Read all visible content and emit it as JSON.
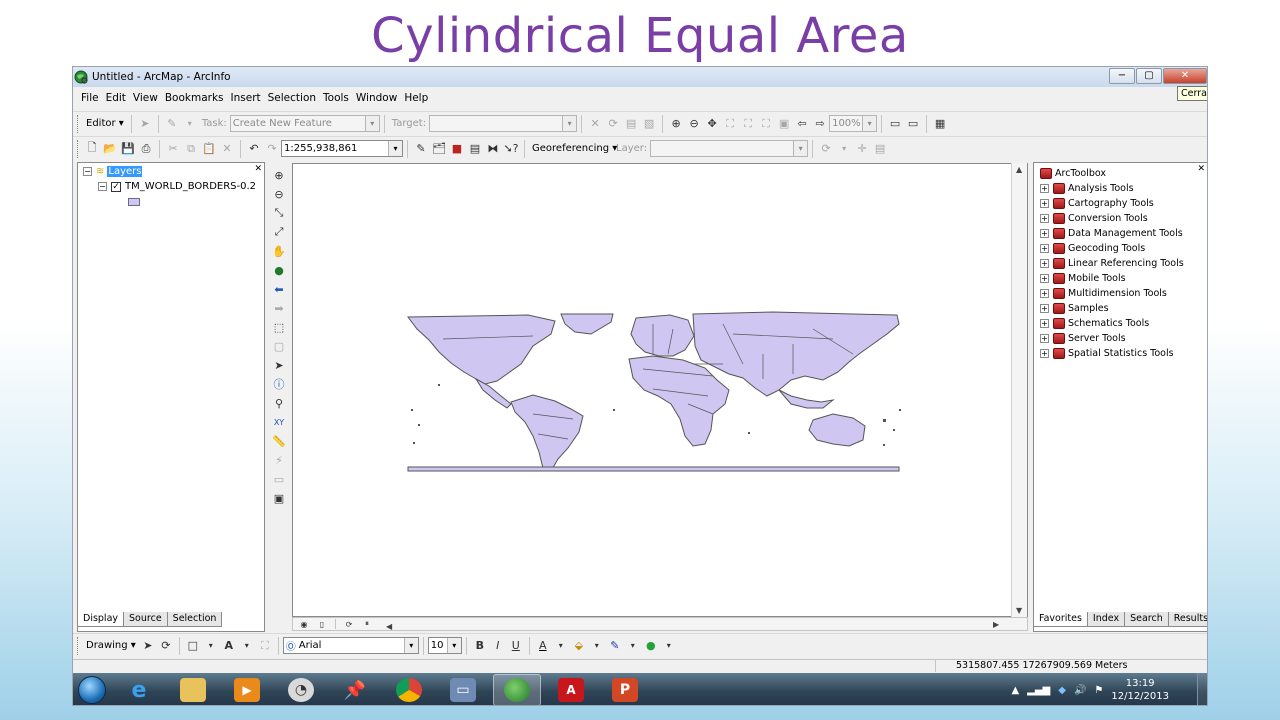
{
  "slide": {
    "title": "Cylindrical Equal Area"
  },
  "window": {
    "title": "Untitled - ArcMap - ArcInfo",
    "min_label": "−",
    "max_label": "▢",
    "close_label": "✕",
    "tooltip": "Cerrar"
  },
  "menu": [
    "File",
    "Edit",
    "View",
    "Bookmarks",
    "Insert",
    "Selection",
    "Tools",
    "Window",
    "Help"
  ],
  "editor_toolbar": {
    "editor_label": "Editor",
    "task_label": "Task:",
    "task_value": "Create New Feature",
    "target_label": "Target:",
    "target_value": "",
    "zoom_value": "100%"
  },
  "standard_toolbar": {
    "scale_value": "1:255,938,861",
    "georef_label": "Georeferencing",
    "layer_label": "Layer:",
    "layer_value": ""
  },
  "toc": {
    "close": "✕",
    "root_label": "Layers",
    "layer_name": "TM_WORLD_BORDERS-0.2",
    "layer_visible": true,
    "symbol_color": "#cfc6f2",
    "tabs": [
      "Display",
      "Source",
      "Selection"
    ],
    "active_tab": "Display"
  },
  "map": {
    "land_color": "#cfc6f2",
    "border_color": "#555555"
  },
  "toolbox": {
    "close": "✕",
    "root_label": "ArcToolbox",
    "items": [
      "Analysis Tools",
      "Cartography Tools",
      "Conversion Tools",
      "Data Management Tools",
      "Geocoding Tools",
      "Linear Referencing Tools",
      "Mobile Tools",
      "Multidimension Tools",
      "Samples",
      "Schematics Tools",
      "Server Tools",
      "Spatial Statistics Tools"
    ],
    "tabs": [
      "Favorites",
      "Index",
      "Search",
      "Results"
    ],
    "active_tab": "Favorites"
  },
  "drawing_toolbar": {
    "drawing_label": "Drawing",
    "font_value": "Arial",
    "size_value": "10",
    "bold": "B",
    "italic": "I",
    "underline": "U",
    "font_color_letter": "A"
  },
  "status": {
    "coordinates": "5315807.455 17267909.569 Meters"
  },
  "taskbar": {
    "time": "13:19",
    "date": "12/12/2013",
    "active_app": "arcmap"
  }
}
